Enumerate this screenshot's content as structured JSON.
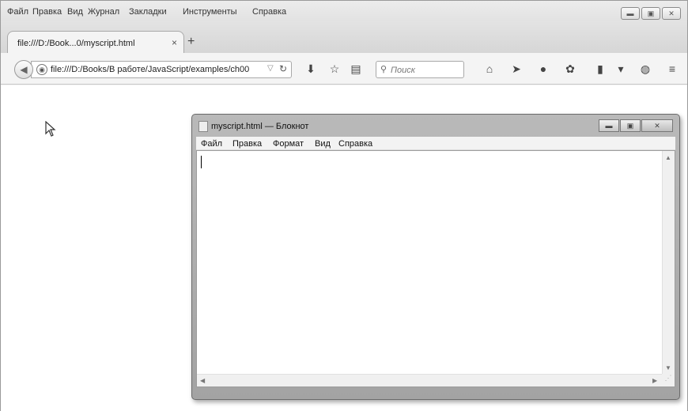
{
  "browser": {
    "menu": [
      "Файл",
      "Правка",
      "Вид",
      "Журнал",
      "Закладки",
      "Инструменты",
      "Справка"
    ],
    "tab": {
      "title": "file:///D:/Book...0/myscript.html",
      "close": "×"
    },
    "new_tab": "+",
    "url": "file:///D:/Books/В работе/JavaScript/examples/ch00",
    "search_placeholder": "Поиск",
    "icons": [
      "back-icon",
      "globe-icon",
      "reload-icon",
      "download-icon",
      "bookmark-star-icon",
      "reading-list-icon",
      "home-icon",
      "send-icon",
      "chat-icon",
      "addons-icon",
      "pocket-icon",
      "dropdown-icon",
      "shield-icon",
      "hamburger-menu-icon"
    ]
  },
  "notepad": {
    "title": "myscript.html — Блокнот",
    "menu": [
      "Файл",
      "Правка",
      "Формат",
      "Вид",
      "Справка"
    ],
    "text": ""
  }
}
